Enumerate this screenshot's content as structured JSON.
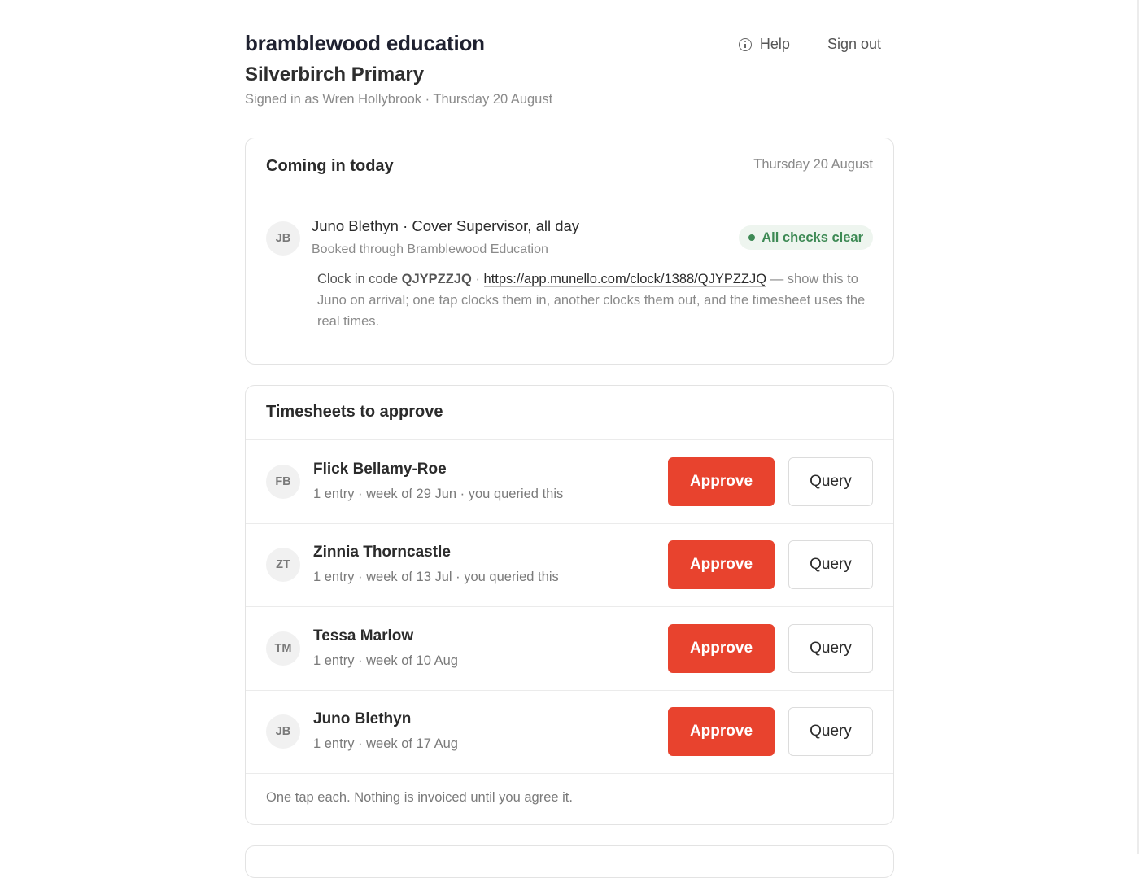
{
  "header": {
    "brand": "bramblewood education",
    "school": "Silverbirch Primary",
    "signed_in": "Signed in as Wren Hollybrook · Thursday 20 August",
    "nav": {
      "help": "Help",
      "sign_out": "Sign out",
      "help_icon": "info-circle-icon"
    }
  },
  "coming_today": {
    "title": "Coming in today",
    "date": "Thursday 20 August",
    "visitor": {
      "initials": "JB",
      "name_line": "Juno Blethyn · Cover Supervisor, all day",
      "sub": "Booked through Bramblewood Education",
      "status": "All checks clear",
      "status_color": "#3e8a55"
    },
    "clock": {
      "prefix": "Clock in code",
      "code": "QJYPZZJQ",
      "sep": " · ",
      "url": "https://app.munello.com/clock/1388/QJYPZZJQ",
      "note": " — show this to Juno on arrival; one tap clocks them in, another clocks them out, and the timesheet uses the real times."
    }
  },
  "timesheets": {
    "title": "Timesheets to approve",
    "approve_label": "Approve",
    "query_label": "Query",
    "approve_color": "#e8432e",
    "rows": [
      {
        "initials": "FB",
        "name": "Flick Bellamy-Roe",
        "meta": "1 entry · week of 29 Jun · you queried this"
      },
      {
        "initials": "ZT",
        "name": "Zinnia Thorncastle",
        "meta": "1 entry · week of 13 Jul · you queried this"
      },
      {
        "initials": "TM",
        "name": "Tessa Marlow",
        "meta": "1 entry · week of 10 Aug"
      },
      {
        "initials": "JB",
        "name": "Juno Blethyn",
        "meta": "1 entry · week of 17 Aug"
      }
    ],
    "footer": "One tap each. Nothing is invoiced until you agree it."
  }
}
